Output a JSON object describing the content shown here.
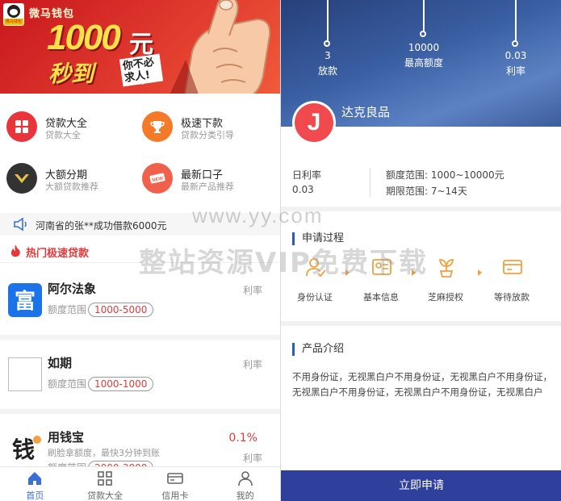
{
  "left": {
    "banner": {
      "brand": "微马钱包",
      "logo_sub": "微马钱包",
      "promo_amount": "1000",
      "promo_unit": "元",
      "promo_sign": "秒到",
      "promo_slogan": "你不必求人!"
    },
    "grid": [
      {
        "title": "贷款大全",
        "subtitle": "贷款大全",
        "icon": "grid-icon",
        "color": "#e8343a"
      },
      {
        "title": "极速下款",
        "subtitle": "贷款分类引导",
        "icon": "trophy-icon",
        "color": "#f47a2a"
      },
      {
        "title": "大额分期",
        "subtitle": "大额贷款推荐",
        "icon": "crown-icon",
        "color": "#333333"
      },
      {
        "title": "最新口子",
        "subtitle": "最新产品推荐",
        "icon": "new-tag-icon",
        "color": "#f0604a"
      }
    ],
    "notice": "河南省的张**成功借款6000元",
    "hot_title": "热门极速贷款",
    "products": [
      {
        "name": "阿尔法象",
        "rate_label": "利率",
        "range_label": "额度范围",
        "range": "1000-5000"
      },
      {
        "name": "如期",
        "rate_label": "利率",
        "range_label": "额度范围",
        "range": "1000-1000"
      },
      {
        "name": "用钱宝",
        "rate_label": "利率",
        "rate": "0.1%",
        "desc": "刷脸拿额度，最快3分钟到账",
        "range_label": "额度范围",
        "range": "2000-3000"
      }
    ],
    "tabs": [
      {
        "label": "首页",
        "icon": "home-icon"
      },
      {
        "label": "贷款大全",
        "icon": "grid-icon"
      },
      {
        "label": "信用卡",
        "icon": "credit-card-icon"
      },
      {
        "label": "我的",
        "icon": "user-icon"
      }
    ]
  },
  "right": {
    "stats": [
      {
        "value": "3",
        "label": "放款"
      },
      {
        "value": "10000",
        "label": "最高额度"
      },
      {
        "value": "0.03",
        "label": "利率"
      }
    ],
    "product_logo_letter": "J",
    "product_name": "达克良品",
    "rate_key": "日利率",
    "rate_value": "0.03",
    "range_text": "额度范围: 1000~10000元",
    "period_text": "期限范围: 7~14天",
    "process_title": "申请过程",
    "steps": [
      {
        "label": "身份认证",
        "icon": "id-verify-icon"
      },
      {
        "label": "基本信息",
        "icon": "profile-card-icon"
      },
      {
        "label": "芝麻授权",
        "icon": "sprout-icon"
      },
      {
        "label": "等待放款",
        "icon": "payment-card-icon"
      }
    ],
    "intro_title": "产品介绍",
    "intro_text": "不用身份证，无视黑白户不用身份证，无视黑白户不用身份证，无视黑白户不用身份证，无视黑白户不用身份证，无视黑白户",
    "apply_button": "立即申请"
  },
  "watermark": {
    "line1": "www.yy.com",
    "line2": "整站资源VIP免费下载"
  },
  "colors": {
    "accent_red": "#e23a3a",
    "accent_blue": "#2f3f9c",
    "tab_active": "#3a6fd8"
  }
}
